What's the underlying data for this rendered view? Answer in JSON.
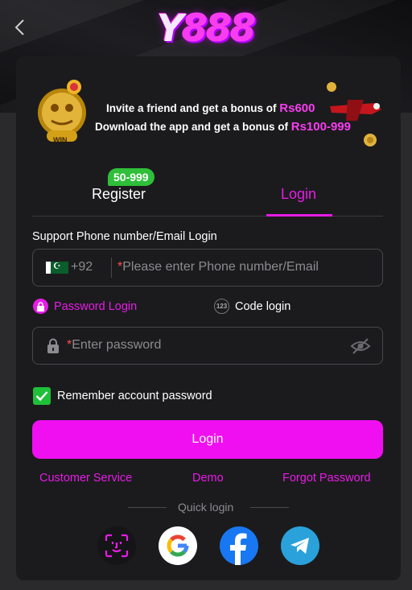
{
  "header": {
    "logo_text": "Y888",
    "logo_y": "Y",
    "logo_num": "888"
  },
  "banner": {
    "line1_prefix": "Invite a friend and get a bonus of ",
    "line1_amount": "Rs600",
    "line2_prefix": "Download the app and get a bonus of ",
    "line2_amount": "Rs100-999",
    "win_label": "WIN"
  },
  "tabs": {
    "register_label": "Register",
    "register_badge": "50-999",
    "login_label": "Login"
  },
  "form": {
    "section_label": "Support Phone number/Email Login",
    "country_code": "+92",
    "phone_placeholder": "Please enter Phone number/Email",
    "password_login_label": "Password Login",
    "code_login_label": "Code login",
    "code_icon_text": "123",
    "password_placeholder": "Enter password",
    "remember_label": "Remember account password",
    "remember_checked": true,
    "login_button": "Login"
  },
  "links": {
    "customer_service": "Customer Service",
    "demo": "Demo",
    "forgot_password": "Forgot Password"
  },
  "quick_login": {
    "label": "Quick login",
    "providers": [
      "face-id-icon",
      "google-icon",
      "facebook-icon",
      "telegram-icon"
    ]
  },
  "colors": {
    "accent": "#e81be8",
    "button": "#f00ff0",
    "badge": "#2fbf3a"
  }
}
